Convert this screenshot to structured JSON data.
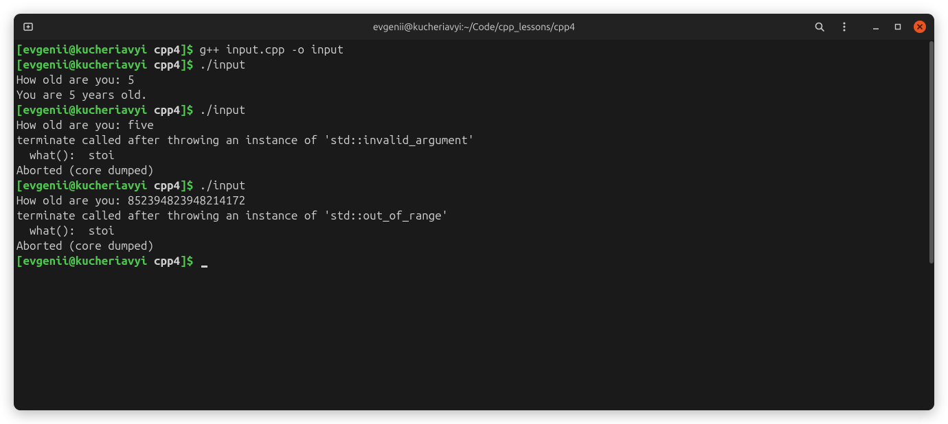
{
  "window": {
    "title": "evgenii@kucheriavyi:~/Code/cpp_lessons/cpp4"
  },
  "prompt": {
    "open_bracket": "[",
    "user": "evgenii",
    "at": "@",
    "host": "kucheriavyi",
    "space": " ",
    "dir": "cpp4",
    "close_bracket": "]",
    "dollar": "$"
  },
  "lines": [
    {
      "type": "prompt",
      "command": "g++ input.cpp -o input"
    },
    {
      "type": "prompt",
      "command": "./input"
    },
    {
      "type": "output",
      "text": "How old are you: 5"
    },
    {
      "type": "output",
      "text": "You are 5 years old."
    },
    {
      "type": "prompt",
      "command": "./input"
    },
    {
      "type": "output",
      "text": "How old are you: five"
    },
    {
      "type": "output",
      "text": "terminate called after throwing an instance of 'std::invalid_argument'"
    },
    {
      "type": "output",
      "text": "  what():  stoi"
    },
    {
      "type": "output",
      "text": "Aborted (core dumped)"
    },
    {
      "type": "prompt",
      "command": "./input"
    },
    {
      "type": "output",
      "text": "How old are you: 852394823948214172"
    },
    {
      "type": "output",
      "text": "terminate called after throwing an instance of 'std::out_of_range'"
    },
    {
      "type": "output",
      "text": "  what():  stoi"
    },
    {
      "type": "output",
      "text": "Aborted (core dumped)"
    },
    {
      "type": "prompt",
      "command": "",
      "cursor": true
    }
  ]
}
